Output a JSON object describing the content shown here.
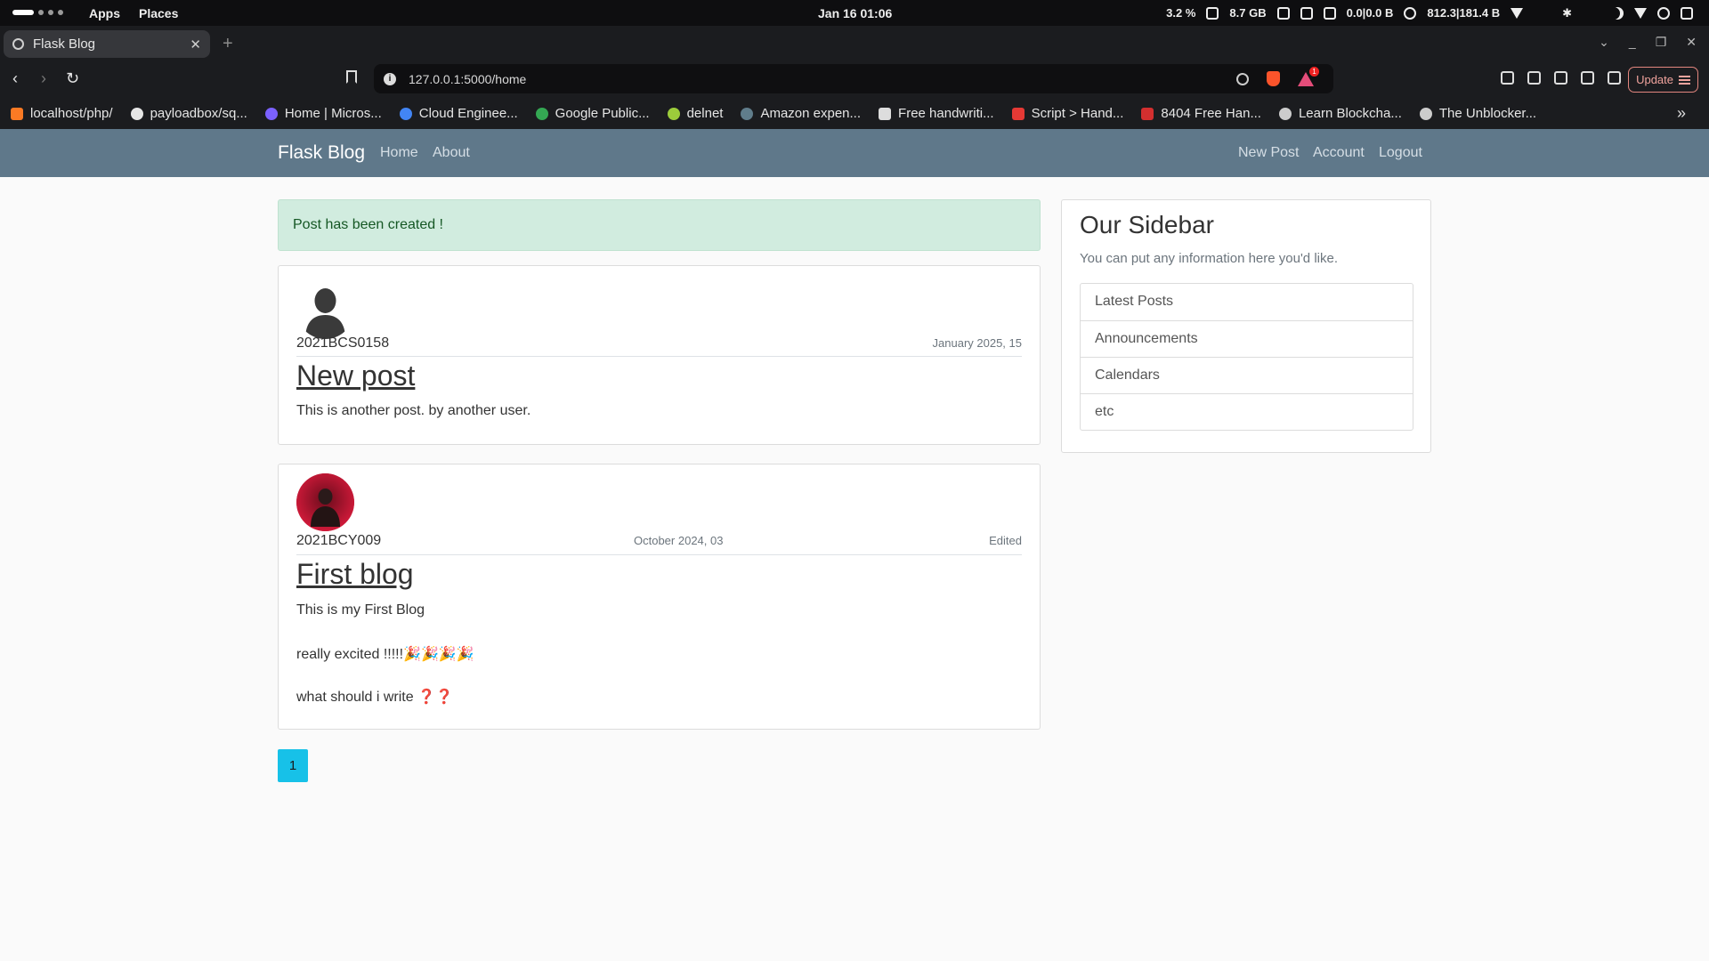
{
  "system_bar": {
    "apps": "Apps",
    "places": "Places",
    "clock": "Jan 16  01:06",
    "cpu": "3.2 %",
    "memory": "8.7 GB",
    "disk_io": "0.0|0.0 B",
    "net": "812.3|181.4 B"
  },
  "browser": {
    "tab_title": "Flask Blog",
    "url": "127.0.0.1:5000/home",
    "rewards_badge": "1",
    "update_label": "Update",
    "bookmarks": [
      {
        "label": "localhost/php/",
        "icon": "xampp-icon",
        "color": "#fb7a24"
      },
      {
        "label": "payloadbox/sq...",
        "icon": "github-icon",
        "color": "#e6e6e6"
      },
      {
        "label": "Home | Micros...",
        "icon": "microsoft-icon",
        "color": "#7b61ff"
      },
      {
        "label": "Cloud Enginee...",
        "icon": "google-cloud-icon",
        "color": "#4285f4"
      },
      {
        "label": "Google Public...",
        "icon": "google-icon",
        "color": "#34a853"
      },
      {
        "label": "delnet",
        "icon": "delnet-icon",
        "color": "#9ccc3b"
      },
      {
        "label": "Amazon expen...",
        "icon": "amazon-icon",
        "color": "#607d8b"
      },
      {
        "label": "Free handwriti...",
        "icon": "handwriting-icon",
        "color": "#dddddd"
      },
      {
        "label": "Script > Hand...",
        "icon": "script-icon",
        "color": "#e53935"
      },
      {
        "label": "8404 Free Han...",
        "icon": "font-icon",
        "color": "#d32f2f"
      },
      {
        "label": "Learn Blockcha...",
        "icon": "globe-icon",
        "color": "#cccccc"
      },
      {
        "label": "The Unblocker...",
        "icon": "globe-icon",
        "color": "#cccccc"
      }
    ]
  },
  "navbar": {
    "brand": "Flask Blog",
    "left_links": [
      "Home",
      "About"
    ],
    "right_links": [
      "New Post",
      "Account",
      "Logout"
    ]
  },
  "alert": {
    "message": "Post has been created !",
    "color": "#d1ecdf"
  },
  "posts": [
    {
      "author": "2021BCS0158",
      "date": "January 2025, 15",
      "title": "New post",
      "body": [
        "This is another post. by another user."
      ],
      "avatar": "default-user-silhouette"
    },
    {
      "author": "2021BCY009",
      "date": "October 2024, 03",
      "edited": "Edited",
      "title": "First blog",
      "body": [
        "This is my First Blog",
        "really excited !!!!!🎉🎉🎉🎉",
        "what should i write ❓❓"
      ],
      "avatar": "user-photo-red"
    }
  ],
  "sidebar": {
    "title": "Our Sidebar",
    "text": "You can put any information here you'd like.",
    "items": [
      "Latest Posts",
      "Announcements",
      "Calendars",
      "etc"
    ]
  },
  "pagination": {
    "current": "1",
    "color": "#17c1e8"
  }
}
